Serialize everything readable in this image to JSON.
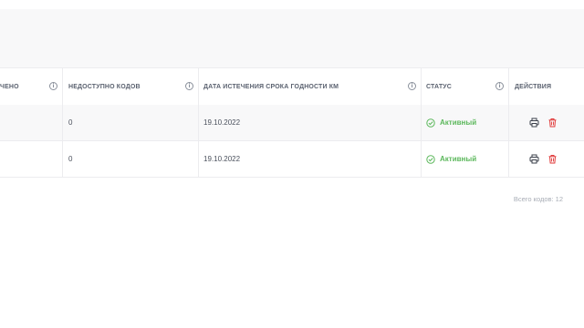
{
  "table": {
    "columns": [
      {
        "label": "ЧЕНО",
        "has_info": true
      },
      {
        "label": "НЕДОСТУПНО КОДОВ",
        "has_info": true
      },
      {
        "label": "ДАТА ИСТЕЧЕНИЯ СРОКА ГОДНОСТИ КМ",
        "has_info": true
      },
      {
        "label": "СТАТУС",
        "has_info": true
      },
      {
        "label": "ДЕЙСТВИЯ",
        "has_info": false
      }
    ],
    "rows": [
      {
        "unavailable": "0",
        "expiry": "19.10.2022",
        "status": "Активный"
      },
      {
        "unavailable": "0",
        "expiry": "19.10.2022",
        "status": "Активный"
      }
    ],
    "info_glyph": "i"
  },
  "footer": {
    "total_label": "Всего кодов: 12"
  },
  "colors": {
    "status_active": "#5cb85c",
    "delete": "#e03a3a",
    "print": "#3a3f4a"
  },
  "icons": {
    "info": "info-icon",
    "status": "check-circle-icon",
    "print": "printer-icon",
    "delete": "trash-icon"
  }
}
